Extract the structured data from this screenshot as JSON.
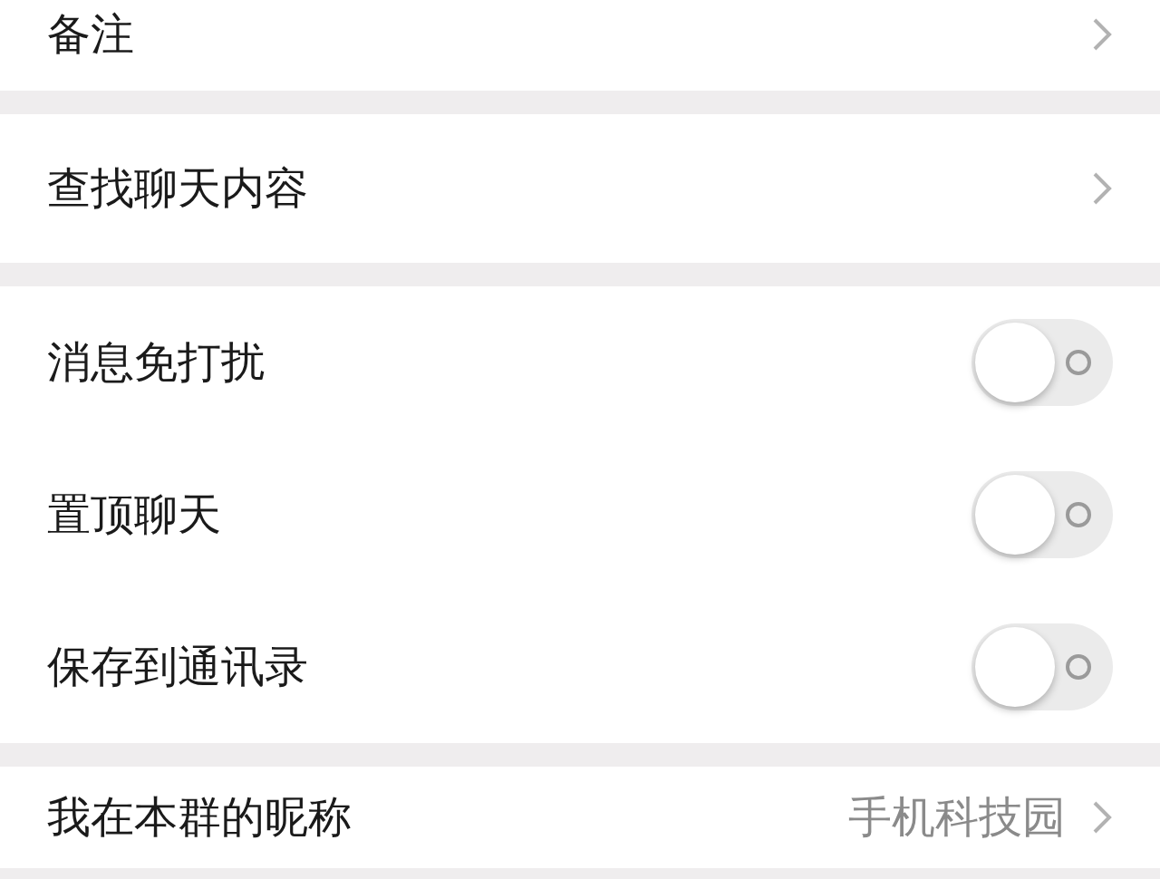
{
  "sections": [
    {
      "rows": [
        {
          "kind": "link",
          "label": "备注"
        }
      ]
    },
    {
      "rows": [
        {
          "kind": "link",
          "label": "查找聊天内容"
        }
      ]
    },
    {
      "rows": [
        {
          "kind": "toggle",
          "label": "消息免打扰",
          "on": false
        },
        {
          "kind": "toggle",
          "label": "置顶聊天",
          "on": false
        },
        {
          "kind": "toggle",
          "label": "保存到通讯录",
          "on": false
        }
      ]
    },
    {
      "rows": [
        {
          "kind": "link",
          "label": "我在本群的昵称",
          "value": "手机科技园"
        }
      ]
    }
  ]
}
